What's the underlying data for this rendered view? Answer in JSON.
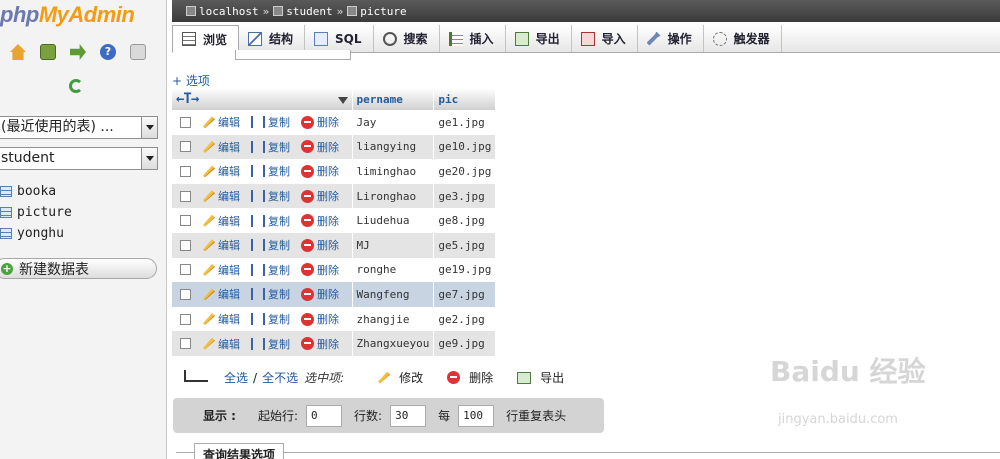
{
  "app": {
    "logo_php": "php",
    "logo_my": "MyAdmin"
  },
  "nav": {
    "recent_select": "(最近使用的表) ...",
    "db_select": "student",
    "tables": [
      "booka",
      "picture",
      "yonghu"
    ],
    "new_table": "新建数据表"
  },
  "breadcrumb": {
    "server": "localhost",
    "database": "student",
    "table": "picture",
    "separator": "»"
  },
  "tabs": [
    "浏览",
    "结构",
    "SQL",
    "搜索",
    "插入",
    "导出",
    "导入",
    "操作",
    "触发器"
  ],
  "options_link": "+ 选项",
  "table": {
    "columns": [
      "pername",
      "pic"
    ],
    "action_labels": {
      "edit": "编辑",
      "copy": "复制",
      "delete": "删除"
    },
    "rows": [
      {
        "pername": "Jay",
        "pic": "ge1.jpg"
      },
      {
        "pername": "liangying",
        "pic": "ge10.jpg"
      },
      {
        "pername": "liminghao",
        "pic": "ge20.jpg"
      },
      {
        "pername": "Lironghao",
        "pic": "ge3.jpg"
      },
      {
        "pername": "Liudehua",
        "pic": "ge8.jpg"
      },
      {
        "pername": "MJ",
        "pic": "ge5.jpg"
      },
      {
        "pername": "ronghe",
        "pic": "ge19.jpg"
      },
      {
        "pername": "Wangfeng",
        "pic": "ge7.jpg"
      },
      {
        "pername": "zhangjie",
        "pic": "ge2.jpg"
      },
      {
        "pername": "Zhangxueyou",
        "pic": "ge9.jpg"
      }
    ]
  },
  "bulk": {
    "select_all": "全选",
    "divider": "/",
    "deselect_all": "全不选",
    "with_selected": "选中项:",
    "edit": "修改",
    "delete": "删除",
    "export": "导出"
  },
  "navbar": {
    "label": "显示 :",
    "start_label": "起始行:",
    "start": "0",
    "rows_label": "行数:",
    "rows": "30",
    "per_label": "每",
    "repeat": "100",
    "repeat_suffix": "行重复表头"
  },
  "query_results": "查询结果选项",
  "watermark": {
    "text": "Baidu 经验",
    "sub": "jingyan.baidu.com"
  },
  "colors": {
    "accent": "#235a9e",
    "row_even": "#e4e4e4",
    "row_hover": "#c8d4e2",
    "crumb_bar": "#4a4a4a"
  }
}
